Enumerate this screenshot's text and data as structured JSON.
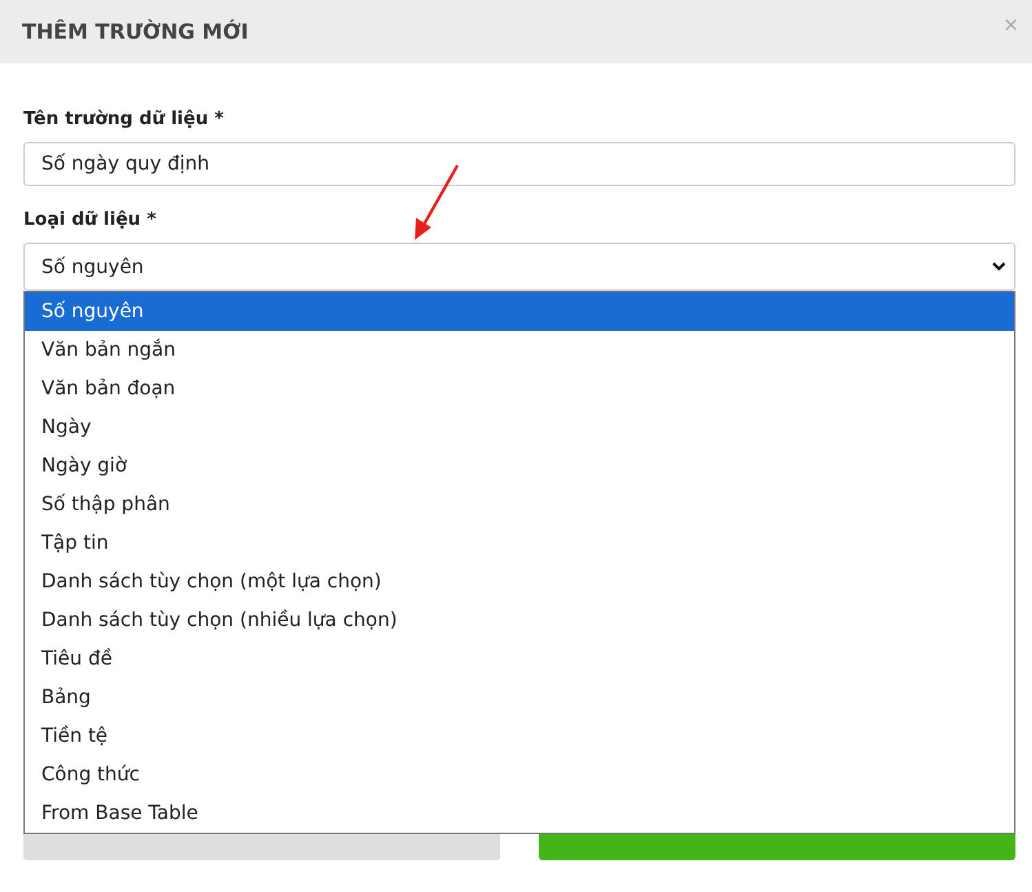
{
  "dialog": {
    "title": "THÊM TRƯỜNG MỚI",
    "close": "×"
  },
  "fields": [
    {
      "kind": "text",
      "label": "Tên trường dữ liệu *",
      "value": "Số ngày quy định"
    },
    {
      "kind": "select",
      "label": "Loại dữ liệu *",
      "value": "Số nguyên",
      "expanded": true
    }
  ],
  "options": [
    {
      "label": "Số nguyên",
      "selected": true
    },
    {
      "label": "Văn bản ngắn",
      "selected": false
    },
    {
      "label": "Văn bản đoạn",
      "selected": false
    },
    {
      "label": "Ngày",
      "selected": false
    },
    {
      "label": "Ngày giờ",
      "selected": false
    },
    {
      "label": "Số thập phân",
      "selected": false
    },
    {
      "label": "Tập tin",
      "selected": false
    },
    {
      "label": "Danh sách tùy chọn (một lựa chọn)",
      "selected": false
    },
    {
      "label": "Danh sách tùy chọn (nhiều lựa chọn)",
      "selected": false
    },
    {
      "label": "Tiêu đề",
      "selected": false
    },
    {
      "label": "Bảng",
      "selected": false
    },
    {
      "label": "Tiền tệ",
      "selected": false
    },
    {
      "label": "Công thức",
      "selected": false
    },
    {
      "label": "From Base Table",
      "selected": false
    }
  ],
  "buttons": [
    {
      "kind": "cancel"
    },
    {
      "kind": "primary"
    }
  ]
}
